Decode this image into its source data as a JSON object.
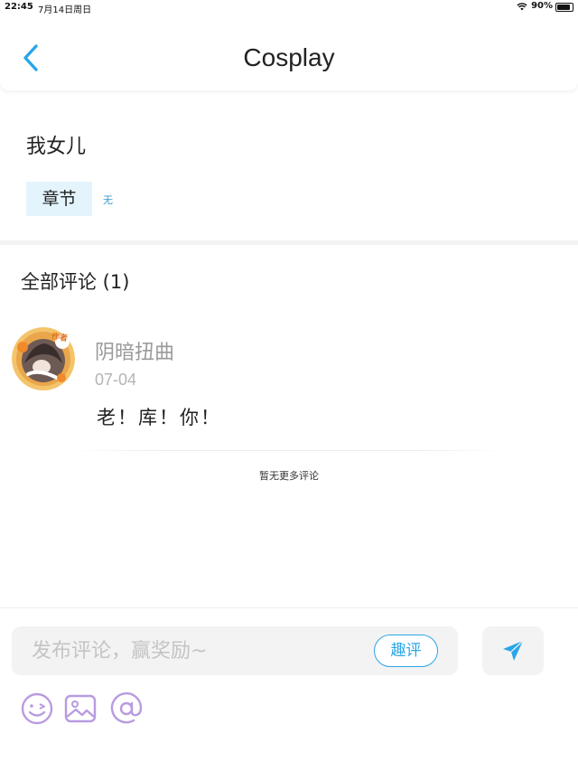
{
  "status_bar": {
    "time": "22:45",
    "date": "7月14日周日",
    "battery": "90%",
    "battery_level": 0.9
  },
  "nav": {
    "back_icon": "chevron-left-icon",
    "title": "Cosplay"
  },
  "post": {
    "title": "我女儿",
    "chapter_label": "章节",
    "chapter_value": "无"
  },
  "comments": {
    "header": "全部评论 (1)",
    "items": [
      {
        "username": "阴暗扭曲",
        "date": "07-04",
        "text": "老！库！你！",
        "badge": "作者"
      }
    ],
    "no_more": "暂无更多评论"
  },
  "composer": {
    "placeholder": "发布评论，赢奖励~",
    "quping_label": "趣评",
    "send_icon": "send-icon",
    "tools": [
      "emoji-icon",
      "image-icon",
      "at-icon"
    ]
  },
  "colors": {
    "accent": "#2aa6e8",
    "tag_bg": "#e3f4fd",
    "tool_icon": "#b99be0"
  }
}
